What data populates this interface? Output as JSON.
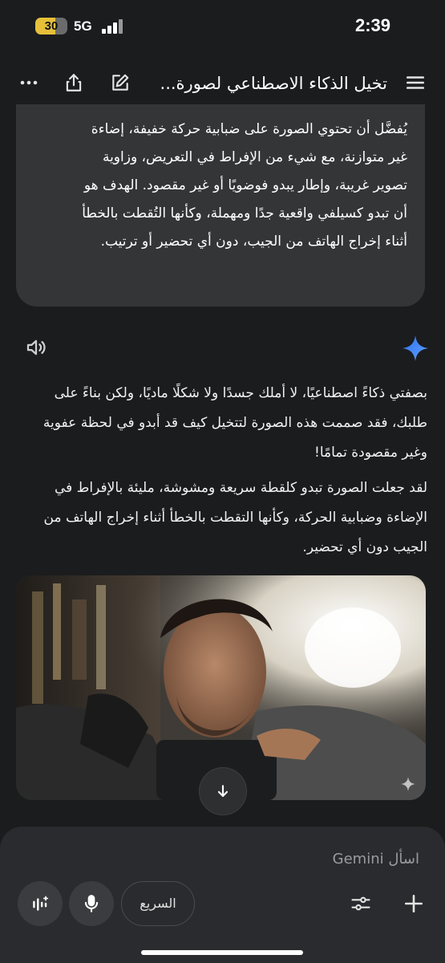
{
  "status_bar": {
    "battery": "30",
    "network": "5G",
    "time": "2:39"
  },
  "header": {
    "title": "تخيل الذكاء الاصطناعي لصورة..."
  },
  "conversation": {
    "user_message": "يُفضَّل أن تحتوي الصورة على ضبابية حركة خفيفة، إضاءة غير متوازنة، مع شيء من الإفراط في التعريض، وزاوية تصوير غريبة، وإطار يبدو فوضويًا أو غير مقصود. الهدف هو أن تبدو كسيلفي واقعية جدًا ومهملة، وكأنها التُقطت بالخطأ أثناء إخراج الهاتف من الجيب، دون أي تحضير أو ترتيب.",
    "reply_paragraphs": [
      "بصفتي ذكاءً اصطناعيًا، لا أملك جسدًا ولا شكلًا ماديًا، ولكن بناءً على طلبك، فقد صممت هذه الصورة لتتخيل كيف قد أبدو في لحظة عفوية وغير مقصودة تمامًا!",
      "لقد جعلت الصورة تبدو كلقطة سريعة ومشوشة، مليئة بالإفراط في الإضاءة وضبابية الحركة، وكأنها التقطت بالخطأ أثناء إخراج الهاتف من الجيب دون أي تحضير."
    ]
  },
  "composer": {
    "placeholder": "اسأل Gemini",
    "model_label": "السريع"
  },
  "icons": {
    "menu": "menu-icon",
    "edit": "edit-icon",
    "share": "share-icon",
    "more": "more-icon",
    "speaker": "speaker-icon",
    "sparkle": "gemini-sparkle-icon",
    "scroll": "arrow-down-icon",
    "add": "plus-icon",
    "tools": "tools-icon",
    "mic": "mic-icon",
    "live": "live-icon"
  },
  "colors": {
    "accent": "#4c8df6",
    "background": "#1b1c1d",
    "bubble": "#333537"
  }
}
